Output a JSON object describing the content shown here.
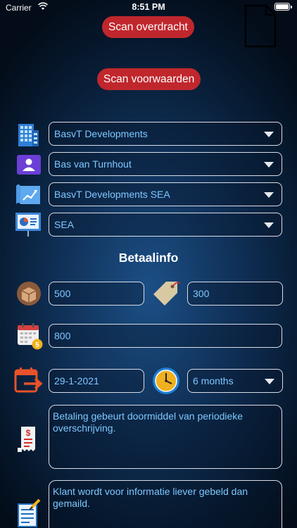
{
  "status_bar": {
    "carrier": "Carrier",
    "time": "8:51 PM",
    "battery_level": 1.0
  },
  "buttons": {
    "scan_transfer": "Scan overdracht",
    "scan_terms": "Scan voorwaarden"
  },
  "dropdowns": {
    "company": "BasvT Developments",
    "contact": "Bas van Turnhout",
    "project": "BasvT Developments SEA",
    "service": "SEA"
  },
  "payment": {
    "heading": "Betaalinfo",
    "amount": "500",
    "price": "300",
    "total": "800",
    "start_date": "29-1-2021",
    "duration": "6 months",
    "payment_terms": "Betaling gebeurt doormiddel van periodieke overschrijving.",
    "contact_notes": "Klant wordt voor informatie liever gebeld dan gemaild."
  },
  "icons": {
    "document": "document-icon",
    "company": "building-icon",
    "contact": "contact-card-icon",
    "project": "chart-blueprint-icon",
    "service": "presentation-icon",
    "amount": "cardboard-box-icon",
    "price": "price-tag-icon",
    "total": "calendar-badge-icon",
    "start_date": "calendar-export-icon",
    "duration": "clock-icon",
    "payment_terms": "receipt-icon",
    "contact_notes": "notepad-icon"
  },
  "colors": {
    "button_red": "#c0272d",
    "field_text": "#7ec8ff",
    "field_border": "#d8dde6"
  }
}
